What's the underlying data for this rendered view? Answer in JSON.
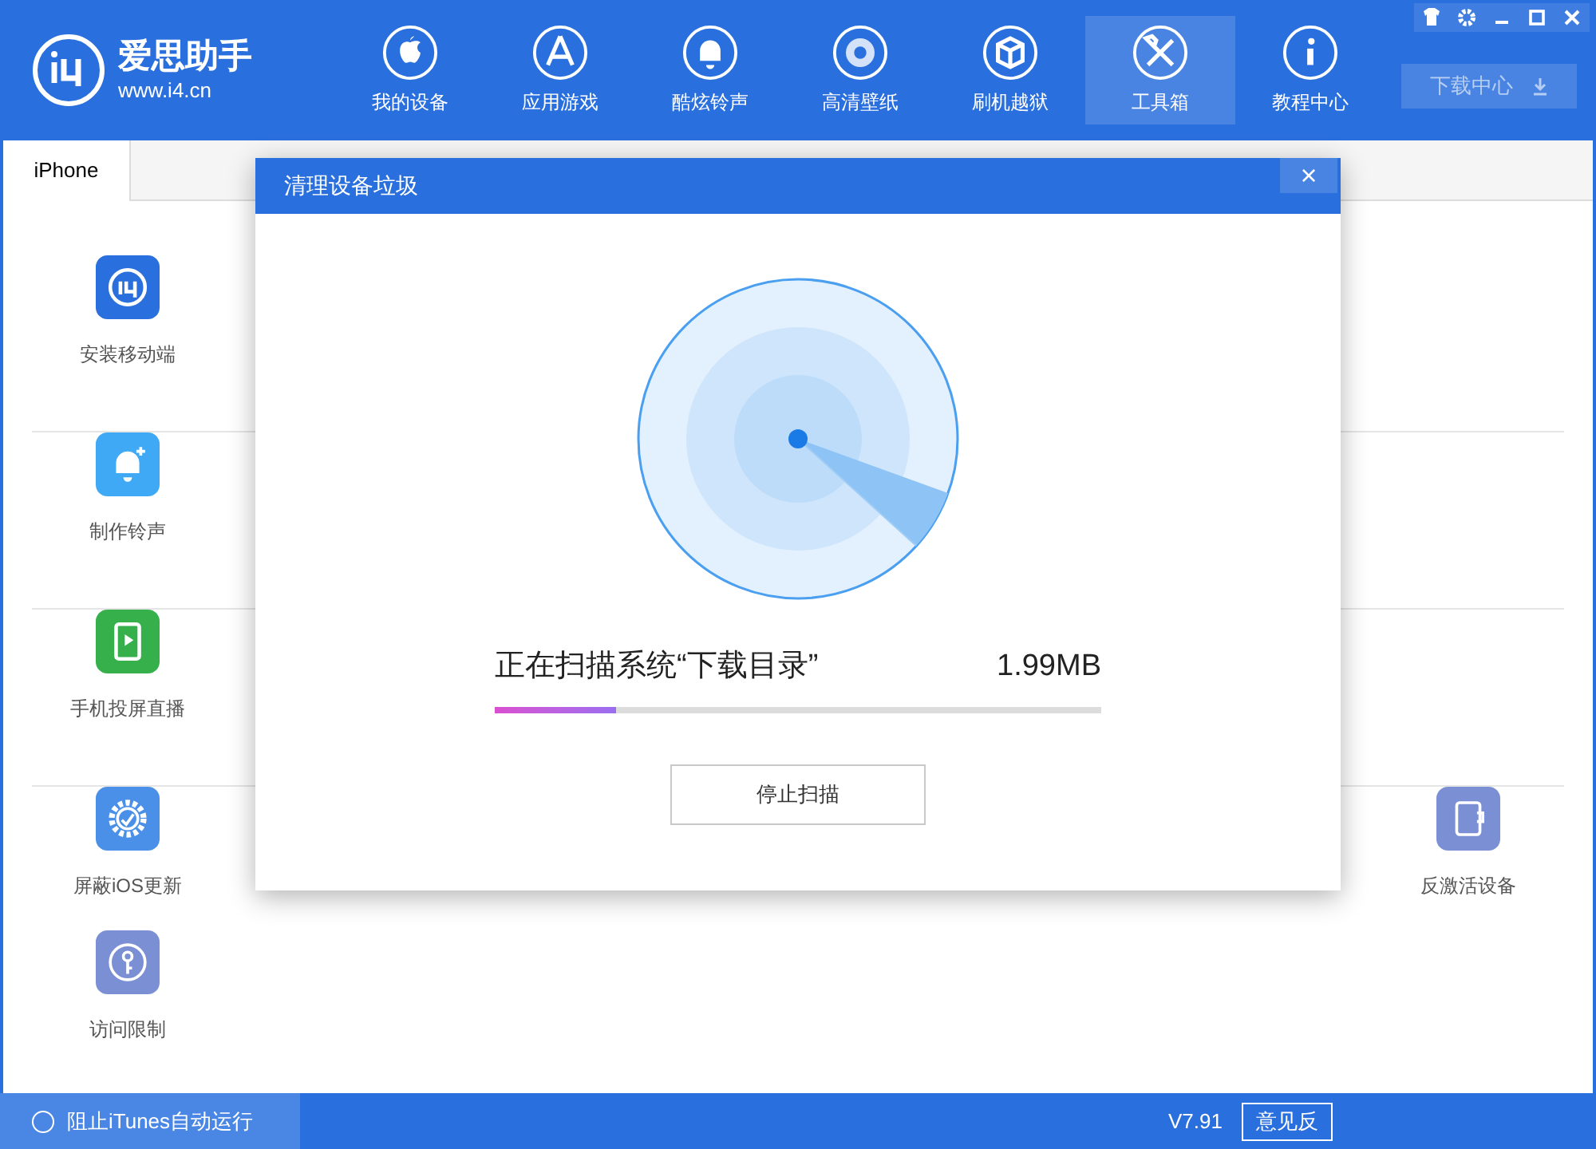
{
  "app": {
    "name": "爱思助手",
    "url": "www.i4.cn"
  },
  "nav": [
    {
      "label": "我的设备",
      "selected": false
    },
    {
      "label": "应用游戏",
      "selected": false
    },
    {
      "label": "酷炫铃声",
      "selected": false
    },
    {
      "label": "高清壁纸",
      "selected": false
    },
    {
      "label": "刷机越狱",
      "selected": false
    },
    {
      "label": "工具箱",
      "selected": true
    },
    {
      "label": "教程中心",
      "selected": false
    }
  ],
  "download_button": "下载中心",
  "tabs": [
    {
      "label": "iPhone",
      "selected": true
    }
  ],
  "tools_left": [
    {
      "label": "安装移动端",
      "color": "#2a6fde"
    },
    {
      "label": "制作铃声",
      "color": "#3fa9f5"
    },
    {
      "label": "手机投屏直播",
      "color": "#36b04a"
    },
    {
      "label": "屏蔽iOS更新",
      "color": "#4a90e8"
    },
    {
      "label": "访问限制",
      "color": "#7b8fd4"
    }
  ],
  "tool_right": {
    "label": "反激活设备",
    "color": "#7b8fd4"
  },
  "dialog": {
    "title": "清理设备垃圾",
    "close": "×",
    "status": "正在扫描系统“下载目录”",
    "size": "1.99MB",
    "level": 0.2,
    "button": "停止扫描"
  },
  "status_bar": {
    "itunes_option": "阻止iTunes自动运行",
    "checked": false,
    "version": "V7.91",
    "feedback": "意见反"
  }
}
